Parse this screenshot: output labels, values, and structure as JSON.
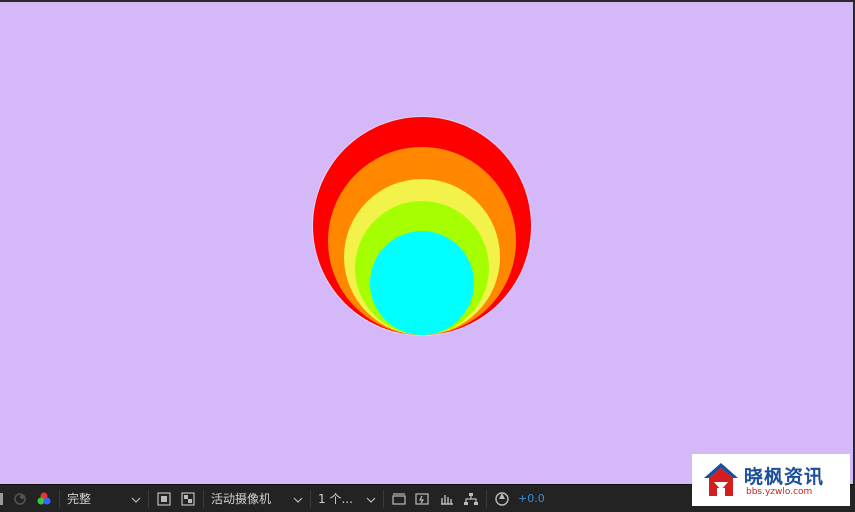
{
  "viewer": {
    "background": "#d5b8f8",
    "rings": [
      {
        "name": "red",
        "color": "#ff0000"
      },
      {
        "name": "orange",
        "color": "#ff8800"
      },
      {
        "name": "yellow",
        "color": "#f2f24a"
      },
      {
        "name": "green",
        "color": "#a6ff00"
      },
      {
        "name": "cyan",
        "color": "#00ffff"
      }
    ]
  },
  "toolbar": {
    "resolution": "完整",
    "camera": "活动摄像机",
    "views": "1 个...",
    "exposure": "+0.0",
    "accent": "#3f8fd9"
  },
  "watermark": {
    "text": "晓枫资讯",
    "url": "bbs.yzwlo.com"
  }
}
